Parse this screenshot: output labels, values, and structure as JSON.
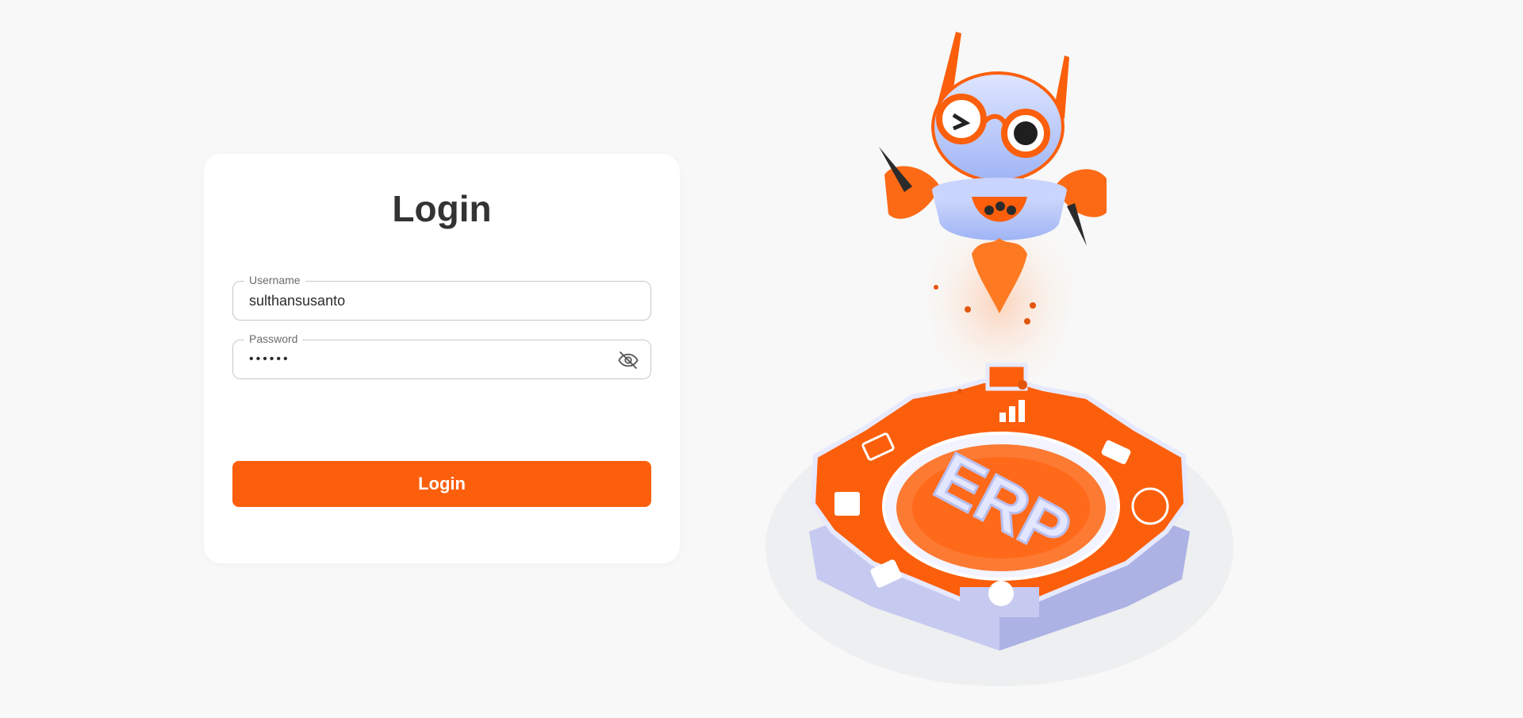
{
  "login_card": {
    "title": "Login",
    "username": {
      "label": "Username",
      "value": "sulthansusanto"
    },
    "password": {
      "label": "Password",
      "value": "••••••"
    },
    "submit_label": "Login"
  },
  "illustration": {
    "gear_text": "ERP"
  },
  "colors": {
    "accent": "#fc5f0c",
    "background": "#f7f8f7",
    "card": "#ffffff",
    "title_text": "#333333"
  }
}
